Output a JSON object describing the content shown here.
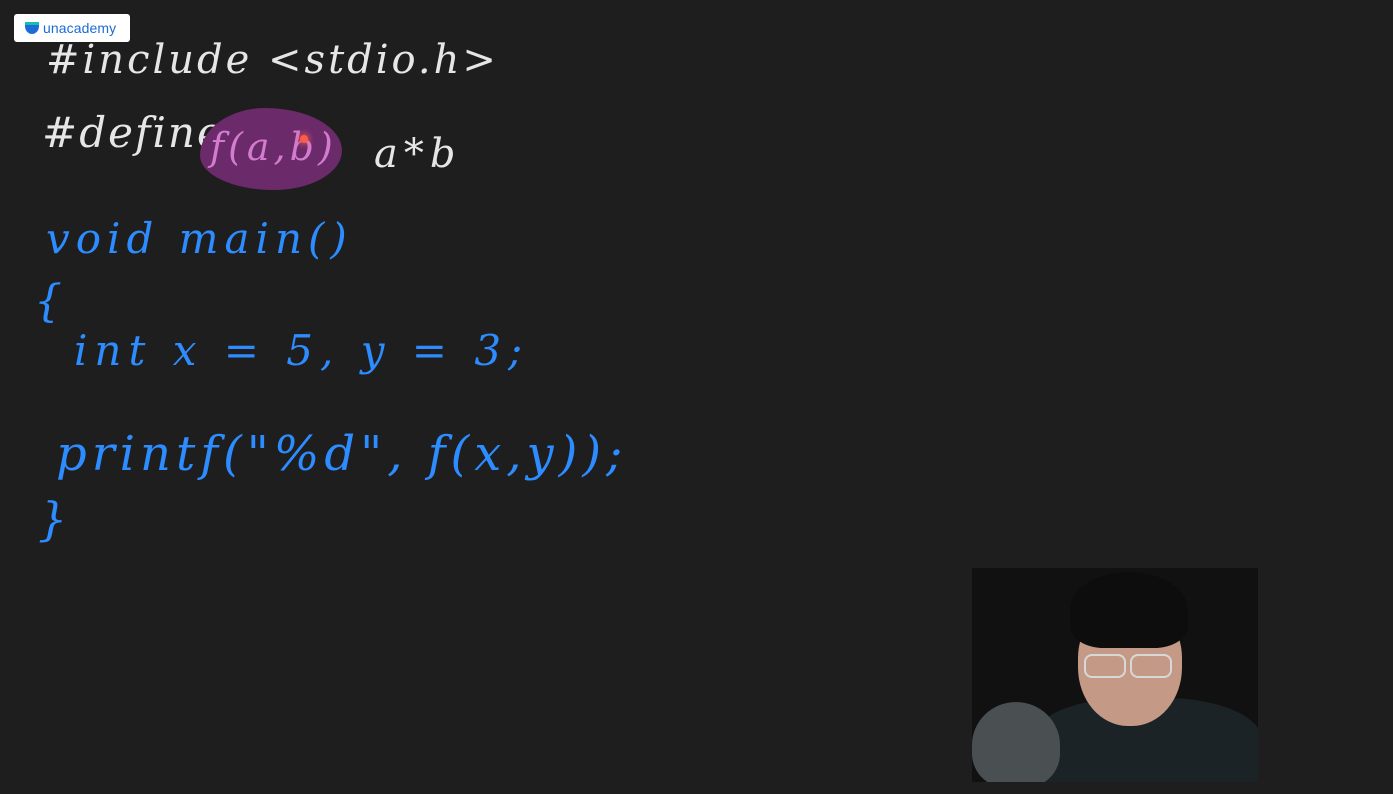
{
  "logo": {
    "text": "unacademy",
    "brand_color": "#1d6bd8",
    "icon": "unacademy-logo-icon"
  },
  "board": {
    "background_color": "#1e1e1e",
    "ink_colors": {
      "white": "#e6e6e6",
      "blue": "#2d8cff",
      "highlight": "#6b2a6a"
    },
    "lines": {
      "include": "#include <stdio.h>",
      "define_keyword": "#define",
      "define_macro": "f(a,b)",
      "define_body": "a*b",
      "main": "void main()",
      "open_brace": "{",
      "decl": "int x = 5, y = 3;",
      "printf": "printf(\"%d\", f(x,y));",
      "close_brace": "}"
    }
  },
  "webcam": {
    "label": "presenter-video"
  }
}
